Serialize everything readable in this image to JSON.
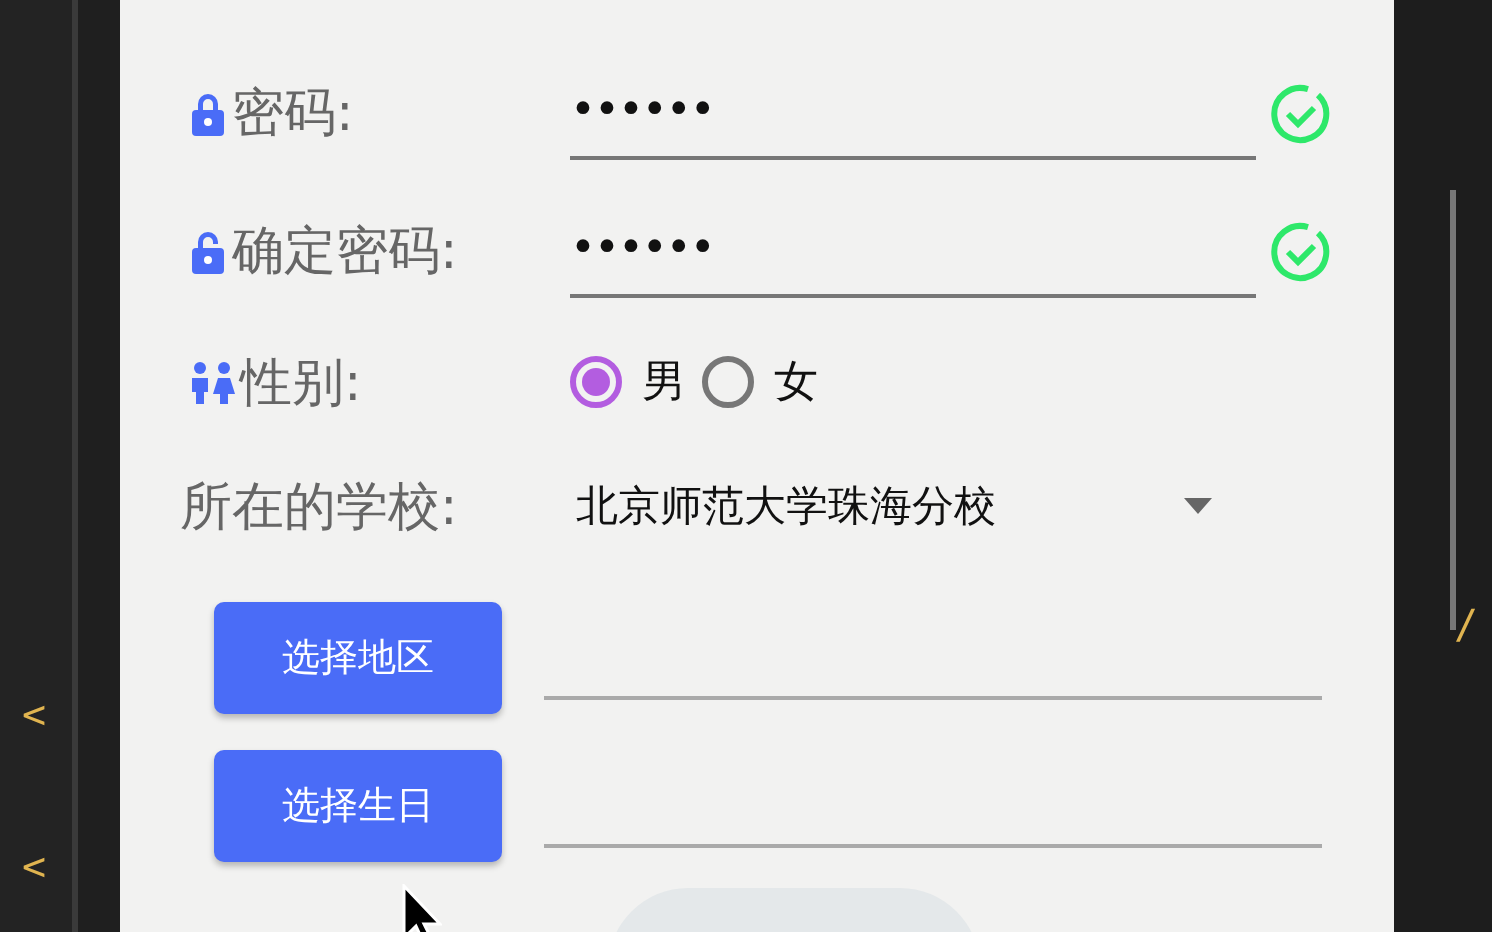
{
  "editor_left": {
    "lines": [
      "<",
      "<"
    ]
  },
  "editor_right": {
    "lines": [
      "/"
    ]
  },
  "form": {
    "fields": [
      {
        "kind": "password",
        "label": "密码:",
        "value": "••••••",
        "valid": true
      },
      {
        "kind": "confirm",
        "label": "确定密码:",
        "value": "••••••",
        "valid": true
      }
    ],
    "gender": {
      "label": "性别:",
      "options": [
        {
          "label": "男",
          "selected": true
        },
        {
          "label": "女",
          "selected": false
        }
      ]
    },
    "school": {
      "label": "所在的学校:",
      "value": "北京师范大学珠海分校"
    },
    "pickers": [
      {
        "button": "选择地区"
      },
      {
        "button": "选择生日"
      }
    ]
  }
}
